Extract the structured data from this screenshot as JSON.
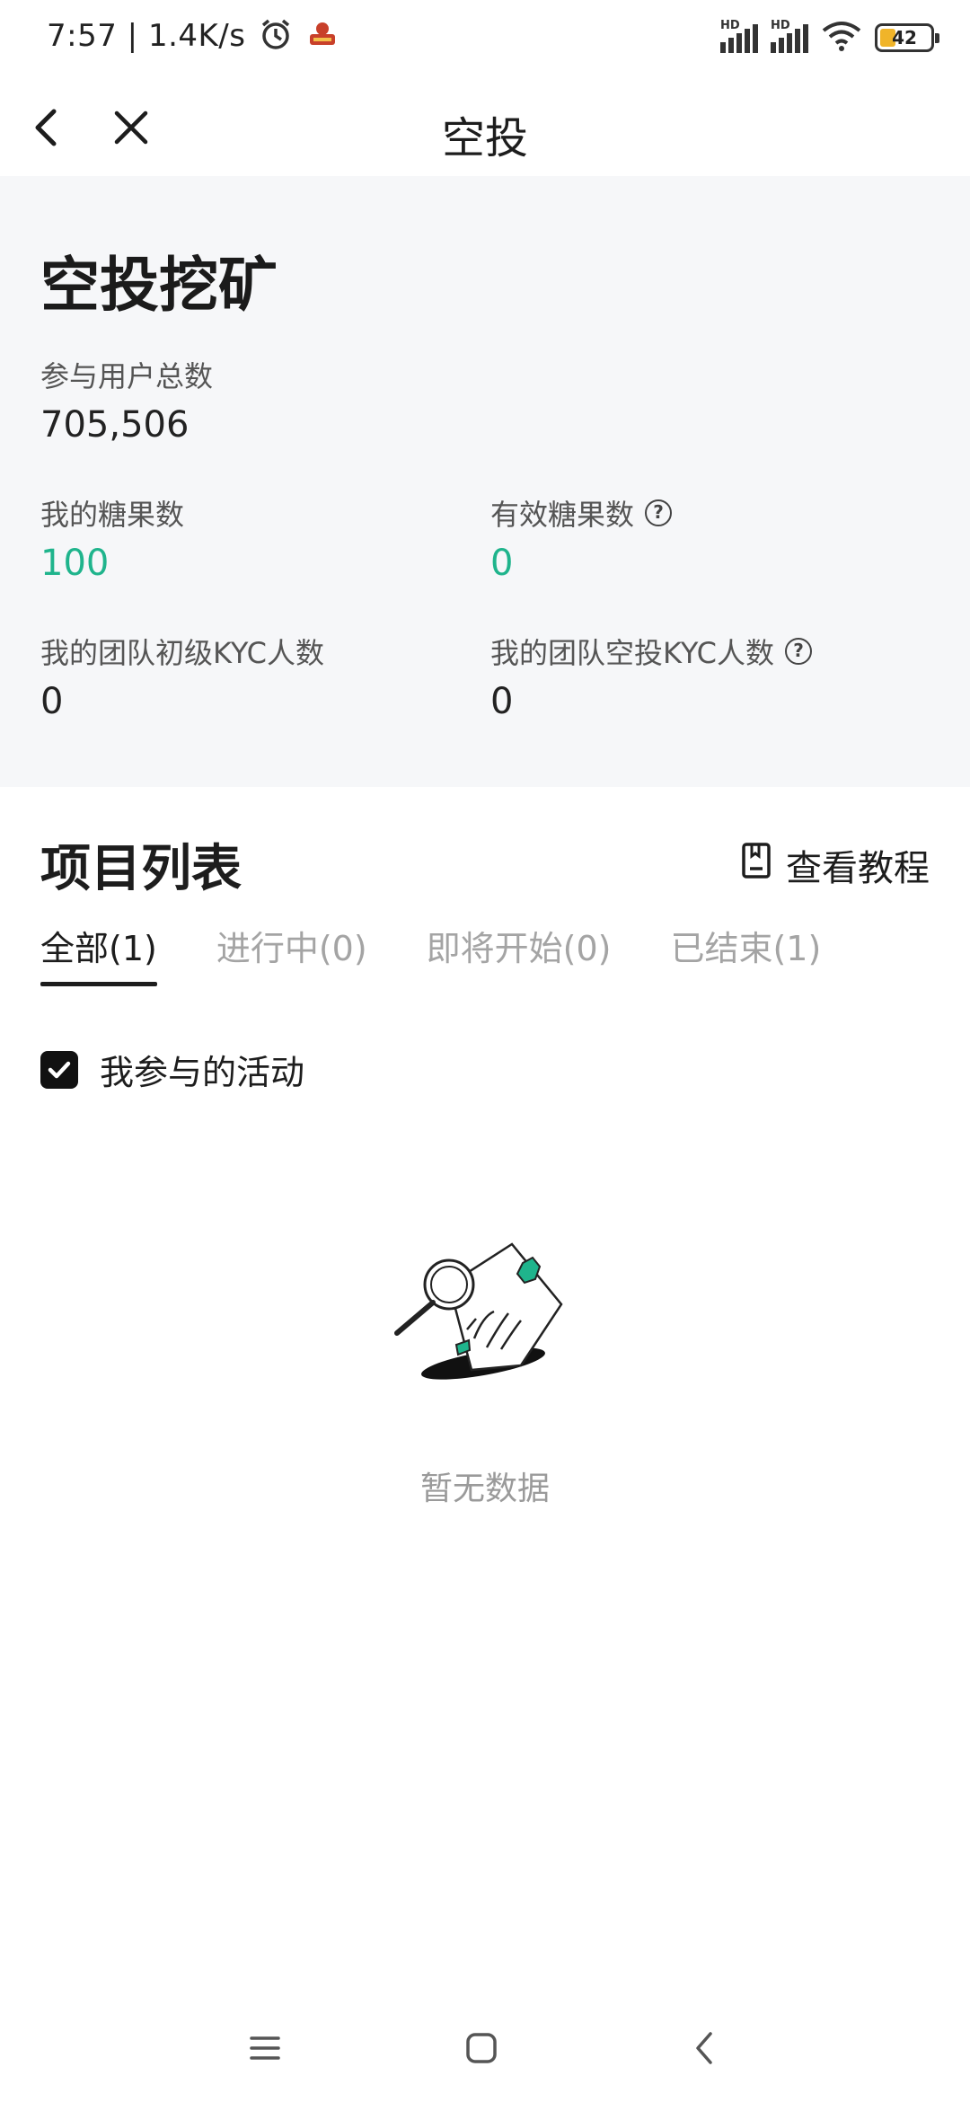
{
  "status_bar": {
    "time": "7:57",
    "speed": "1.4K/s",
    "signal_label": "HD",
    "battery": "42"
  },
  "nav": {
    "title": "空投"
  },
  "stats": {
    "title": "空投挖矿",
    "total_users_label": "参与用户总数",
    "total_users_value": "705,506",
    "my_candies_label": "我的糖果数",
    "my_candies_value": "100",
    "valid_candies_label": "有效糖果数",
    "valid_candies_value": "0",
    "team_basic_kyc_label": "我的团队初级KYC人数",
    "team_basic_kyc_value": "0",
    "team_airdrop_kyc_label": "我的团队空投KYC人数",
    "team_airdrop_kyc_value": "0",
    "help_symbol": "?"
  },
  "projects": {
    "title": "项目列表",
    "tutorial_label": "查看教程",
    "tabs": [
      {
        "label": "全部(1)"
      },
      {
        "label": "进行中(0)"
      },
      {
        "label": "即将开始(0)"
      },
      {
        "label": "已结束(1)"
      }
    ],
    "active_tab_index": 0,
    "filter_label": "我参与的活动",
    "filter_checked": true,
    "empty_text": "暂无数据"
  },
  "colors": {
    "accent": "#1fb48c",
    "panel_bg": "#f6f7f9"
  },
  "icons": [
    "back-icon",
    "close-icon",
    "question-icon",
    "tutorial-icon",
    "checkbox-checked-icon",
    "empty-state-illustration",
    "menu-icon",
    "home-icon",
    "back-nav-icon"
  ]
}
